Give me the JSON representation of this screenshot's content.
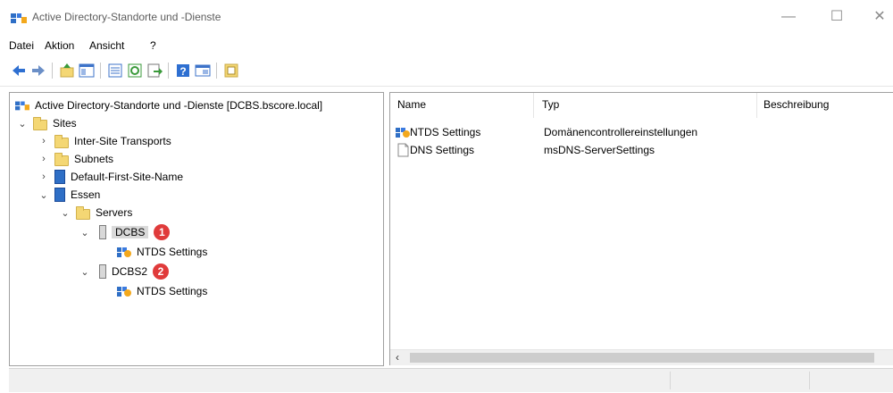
{
  "window": {
    "title": "Active Directory-Standorte und -Dienste",
    "controls": [
      "—",
      "☐",
      "✕"
    ]
  },
  "menu": [
    "Datei",
    "Aktion",
    "Ansicht",
    "?"
  ],
  "toolbar": {
    "icons": [
      "back-arrow-icon",
      "forward-arrow-icon",
      "up-folder-icon",
      "show-tree-icon",
      "properties-icon",
      "refresh-icon",
      "export-icon",
      "help-icon",
      "console-icon",
      "new-object-icon"
    ]
  },
  "tree": {
    "root": "Active Directory-Standorte und -Dienste [DCBS.bscore.local]",
    "sites": "Sites",
    "inter_site": "Inter-Site Transports",
    "subnets": "Subnets",
    "default_site": "Default-First-Site-Name",
    "essen": "Essen",
    "servers": "Servers",
    "dcbs": "DCBS",
    "dcbs_badge": "1",
    "dcbs_ntds": "NTDS Settings",
    "dcbs2": "DCBS2",
    "dcbs2_badge": "2",
    "dcbs2_ntds": "NTDS Settings"
  },
  "list": {
    "headers": [
      "Name",
      "Typ",
      "Beschreibung"
    ],
    "rows": [
      {
        "name": "NTDS Settings",
        "type": "Domänencontrollereinstellungen",
        "icon": "ntds-settings-icon"
      },
      {
        "name": "DNS Settings",
        "type": "msDNS-ServerSettings",
        "icon": "document-icon"
      }
    ]
  },
  "colors": {
    "badge": "#e03b3b",
    "selection": "#d9d9d9",
    "folder": "#f4d774",
    "site": "#2f6fc6"
  }
}
